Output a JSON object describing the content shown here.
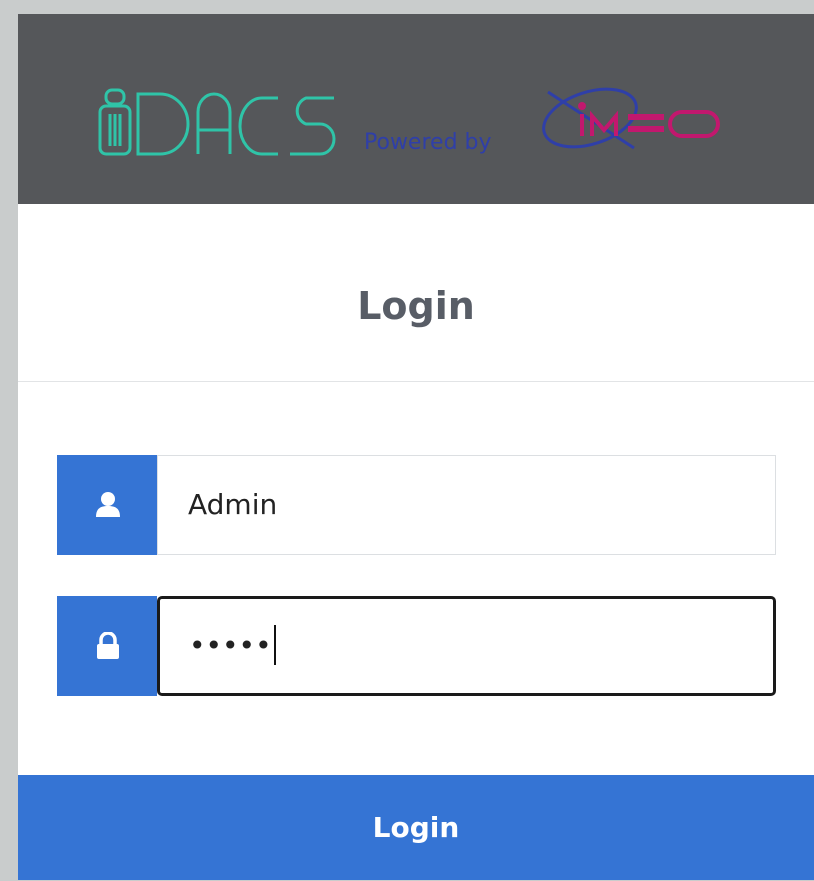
{
  "header": {
    "brand_text": "DACS",
    "powered_by": "Powered by",
    "partner_logo_text": "iMEO",
    "colors": {
      "header_bg": "#55575a",
      "brand": "#2fc4a8",
      "partner_blue": "#2f3fa8",
      "partner_magenta": "#c2186e"
    }
  },
  "form": {
    "title": "Login",
    "username": {
      "icon": "user-icon",
      "value": "Admin"
    },
    "password": {
      "icon": "lock-icon",
      "masked_value": "•••••"
    },
    "submit_label": "Login"
  },
  "colors": {
    "accent": "#3574d4",
    "title_text": "#585d66"
  }
}
